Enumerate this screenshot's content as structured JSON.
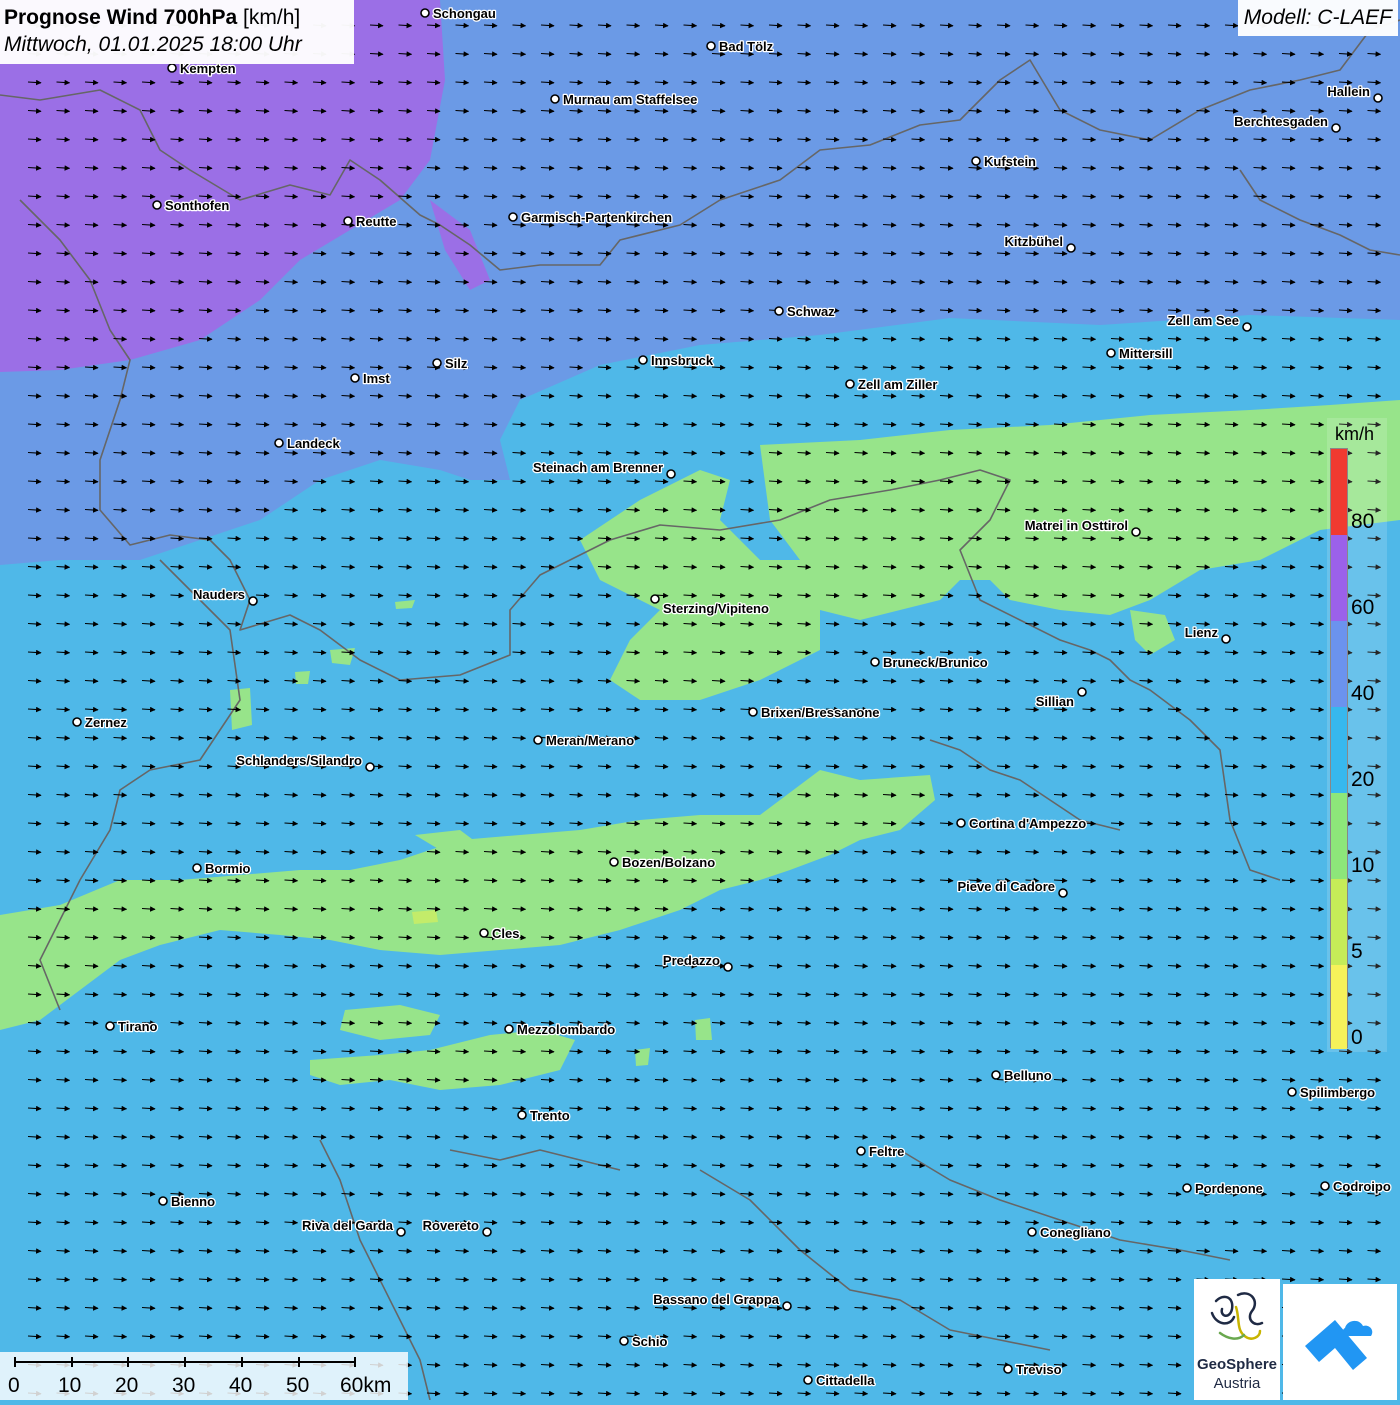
{
  "title": {
    "main": "Prognose Wind 700hPa",
    "unit": "[km/h]",
    "datetime": "Mittwoch, 01.01.2025 18:00 Uhr"
  },
  "model": "Modell: C-LAEF",
  "colors": {
    "background": "#4fb8e8",
    "band_purple": "#9b6fe6",
    "band_blue": "#6b9ae6",
    "band_green": "#97e48a",
    "band_lightgreen": "#c3ec6a",
    "borders": "#666666",
    "arrows": "#000000"
  },
  "legend": {
    "unit": "km/h",
    "labels": [
      "80",
      "60",
      "40",
      "20",
      "10",
      "5",
      "0"
    ],
    "segments": [
      {
        "color": "#f03a30"
      },
      {
        "color": "#9b61ea"
      },
      {
        "color": "#6b93ee"
      },
      {
        "color": "#37b8ee"
      },
      {
        "color": "#8de67a"
      },
      {
        "color": "#c6ec58"
      },
      {
        "color": "#f6f25a"
      }
    ]
  },
  "scalebar": {
    "labels": [
      "0",
      "10",
      "20",
      "30",
      "40",
      "50",
      "60km"
    ]
  },
  "logos": {
    "geosphere_name": "GeoSphere",
    "geosphere_sub": "Austria"
  },
  "cities": [
    {
      "name": "Schongau"
    },
    {
      "name": "Bad Tölz"
    },
    {
      "name": "Kempten"
    },
    {
      "name": "Murnau am Staffelsee"
    },
    {
      "name": "Hallein"
    },
    {
      "name": "Berchtesgaden"
    },
    {
      "name": "Kufstein"
    },
    {
      "name": "Sonthofen"
    },
    {
      "name": "Reutte"
    },
    {
      "name": "Garmisch-Partenkirchen"
    },
    {
      "name": "Kitzbühel"
    },
    {
      "name": "Schwaz"
    },
    {
      "name": "Zell am See"
    },
    {
      "name": "Mittersill"
    },
    {
      "name": "Innsbruck"
    },
    {
      "name": "Silz"
    },
    {
      "name": "Imst"
    },
    {
      "name": "Zell am Ziller"
    },
    {
      "name": "Landeck"
    },
    {
      "name": "Steinach am Brenner"
    },
    {
      "name": "Matrei in Osttirol"
    },
    {
      "name": "Nauders"
    },
    {
      "name": "Sterzing/Vipiteno"
    },
    {
      "name": "Lienz"
    },
    {
      "name": "Bruneck/Brunico"
    },
    {
      "name": "Sillian"
    },
    {
      "name": "Brixen/Bressanone"
    },
    {
      "name": "Zernez"
    },
    {
      "name": "Meran/Merano"
    },
    {
      "name": "Schlanders/Silandro"
    },
    {
      "name": "Cortina d'Ampezzo"
    },
    {
      "name": "Bozen/Bolzano"
    },
    {
      "name": "Bormio"
    },
    {
      "name": "Pieve di Cadore"
    },
    {
      "name": "Cles"
    },
    {
      "name": "Predazzo"
    },
    {
      "name": "Tirano"
    },
    {
      "name": "Mezzolombardo"
    },
    {
      "name": "Belluno"
    },
    {
      "name": "Spilimbergo"
    },
    {
      "name": "Trento"
    },
    {
      "name": "Feltre"
    },
    {
      "name": "Pordenone"
    },
    {
      "name": "Codroipo"
    },
    {
      "name": "Bienno"
    },
    {
      "name": "Riva del Garda"
    },
    {
      "name": "Rovereto"
    },
    {
      "name": "Conegliano"
    },
    {
      "name": "Bassano del Grappa"
    },
    {
      "name": "Schio"
    },
    {
      "name": "Treviso"
    },
    {
      "name": "Cittadella"
    }
  ]
}
